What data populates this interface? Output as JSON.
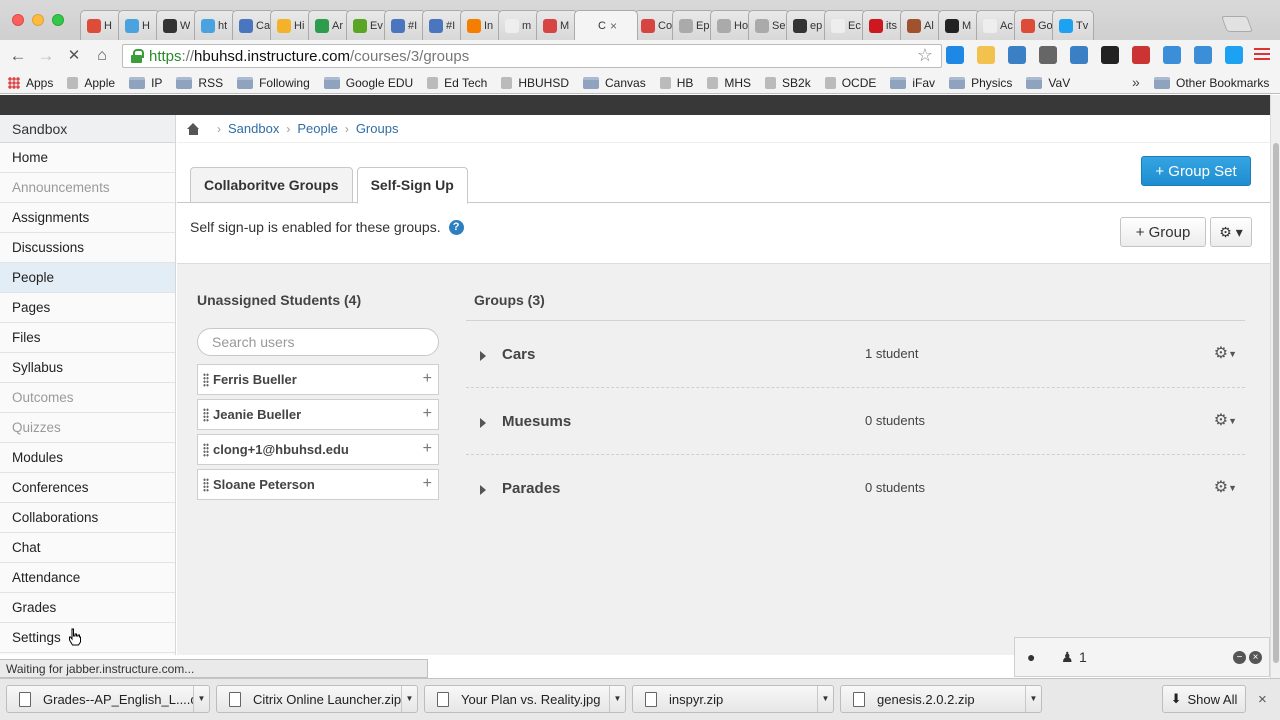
{
  "browser": {
    "tabs": [
      {
        "title": "H",
        "color": "#dd4b39"
      },
      {
        "title": "H",
        "color": "#4aa3df"
      },
      {
        "title": "W",
        "color": "#333333"
      },
      {
        "title": "ht",
        "color": "#4aa3df"
      },
      {
        "title": "Ca",
        "color": "#4a76c0"
      },
      {
        "title": "Hi",
        "color": "#f3b22a"
      },
      {
        "title": "Ar",
        "color": "#2e9b4d"
      },
      {
        "title": "Ev",
        "color": "#5ba525"
      },
      {
        "title": "#I",
        "color": "#4a76c0"
      },
      {
        "title": "#I",
        "color": "#4a76c0"
      },
      {
        "title": "In",
        "color": "#f57d00"
      },
      {
        "title": "m",
        "color": "#eeeeee"
      },
      {
        "title": "M",
        "color": "#d64541"
      },
      {
        "title": "C",
        "color": "#f4f4f4",
        "active": true
      },
      {
        "title": "Co",
        "color": "#d64541"
      },
      {
        "title": "Ep",
        "color": "#aaaaaa"
      },
      {
        "title": "Ho",
        "color": "#aaaaaa"
      },
      {
        "title": "Se",
        "color": "#aaaaaa"
      },
      {
        "title": "ep",
        "color": "#333333"
      },
      {
        "title": "Ec",
        "color": "#eeeeee"
      },
      {
        "title": "its",
        "color": "#cc181e"
      },
      {
        "title": "Al",
        "color": "#a0522d"
      },
      {
        "title": "M",
        "color": "#222222"
      },
      {
        "title": "Ac",
        "color": "#eeeeee"
      },
      {
        "title": "Go",
        "color": "#dd4b39"
      },
      {
        "title": "Tv",
        "color": "#1da1f2"
      }
    ],
    "active_tab_close": "×",
    "url_scheme": "https",
    "url_host": "hbuhsd.instructure.com",
    "url_path": "/courses/3/groups",
    "url_sep": "://",
    "extensions": [
      "#1e88e5",
      "#f2c14e",
      "#3b7fc4",
      "#666666",
      "#3b7fc4",
      "#222222",
      "#cc3333",
      "#3b8fd9",
      "#3b8fd9",
      "#1da1f2"
    ],
    "bookmarks": [
      {
        "label": "Apps",
        "icon": "apps-grid-icon"
      },
      {
        "label": "Apple",
        "icon": "apple-icon"
      },
      {
        "label": "IP",
        "icon": "folder-icon"
      },
      {
        "label": "RSS",
        "icon": "folder-icon"
      },
      {
        "label": "Following",
        "icon": "folder-icon"
      },
      {
        "label": "Google EDU",
        "icon": "folder-icon"
      },
      {
        "label": "Ed Tech",
        "icon": "hourglass-icon"
      },
      {
        "label": "HBUHSD",
        "icon": "person-icon"
      },
      {
        "label": "Canvas",
        "icon": "folder-icon"
      },
      {
        "label": "HB",
        "icon": "canvas-logo-icon"
      },
      {
        "label": "MHS",
        "icon": "mhs-logo-icon"
      },
      {
        "label": "SB2k",
        "icon": "page-icon"
      },
      {
        "label": "OCDE",
        "icon": "page-icon"
      },
      {
        "label": "iFav",
        "icon": "folder-icon"
      },
      {
        "label": "Physics",
        "icon": "folder-icon"
      },
      {
        "label": "VaV",
        "icon": "folder-icon"
      }
    ],
    "bookmarks_overflow": "»",
    "other_bookmarks": "Other Bookmarks"
  },
  "nav": {
    "course": "Sandbox",
    "items": [
      {
        "label": "Home",
        "state": "normal"
      },
      {
        "label": "Announcements",
        "state": "disabled"
      },
      {
        "label": "Assignments",
        "state": "normal"
      },
      {
        "label": "Discussions",
        "state": "normal"
      },
      {
        "label": "People",
        "state": "active"
      },
      {
        "label": "Pages",
        "state": "normal"
      },
      {
        "label": "Files",
        "state": "normal"
      },
      {
        "label": "Syllabus",
        "state": "normal"
      },
      {
        "label": "Outcomes",
        "state": "disabled"
      },
      {
        "label": "Quizzes",
        "state": "disabled"
      },
      {
        "label": "Modules",
        "state": "normal"
      },
      {
        "label": "Conferences",
        "state": "normal"
      },
      {
        "label": "Collaborations",
        "state": "normal"
      },
      {
        "label": "Chat",
        "state": "normal"
      },
      {
        "label": "Attendance",
        "state": "normal"
      },
      {
        "label": "Grades",
        "state": "normal"
      },
      {
        "label": "Settings",
        "state": "normal"
      }
    ]
  },
  "breadcrumb": [
    "Sandbox",
    "People",
    "Groups"
  ],
  "breadcrumb_sep": "›",
  "group_tabs": [
    "Collaboritve Groups",
    "Self-Sign Up"
  ],
  "buttons": {
    "group_set": "+ Group Set",
    "group": "+ Group",
    "settings_gear": "⚙ ▾"
  },
  "info_text": "Self sign-up is enabled for these groups.",
  "help": "?",
  "unassigned": {
    "title": "Unassigned Students (4)",
    "search_placeholder": "Search users",
    "students": [
      "Ferris Bueller",
      "Jeanie Bueller",
      "clong+1@hbuhsd.edu",
      "Sloane Peterson"
    ],
    "add_symbol": "+"
  },
  "groups": {
    "title": "Groups (3)",
    "items": [
      {
        "name": "Cars",
        "count": "1 student"
      },
      {
        "name": "Muesums",
        "count": "0 students"
      },
      {
        "name": "Parades",
        "count": "0 students"
      }
    ]
  },
  "chat_widget": {
    "online_count": "1"
  },
  "status_text": "Waiting for jabber.instructure.com...",
  "downloads": {
    "items": [
      "Grades--AP_English_L....csv",
      "Citrix Online Launcher.zip",
      "Your Plan vs. Reality.jpg",
      "inspyr.zip",
      "genesis.2.0.2.zip"
    ],
    "show_all": "Show All",
    "close": "×"
  }
}
